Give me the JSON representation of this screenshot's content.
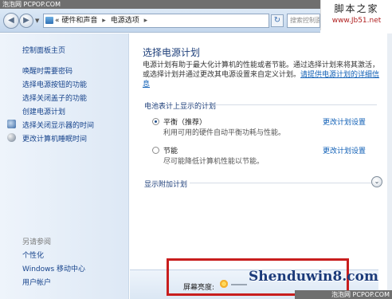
{
  "watermarks": {
    "top_left": "泡泡网 PCPOP.COM",
    "top_right_big": "脚本之家",
    "top_right_small": "www.Jb51.net",
    "center_brand": "Shenduwin8.com",
    "bottom_right": "泡泡网 PCPOP.COM"
  },
  "addressbar": {
    "back_icon": "back-arrow",
    "forward_icon": "forward-arrow",
    "breadcrumb": [
      "«",
      "硬件和声音",
      "▸",
      "电源选项",
      "▸"
    ],
    "search_placeholder": "搜索控制面板"
  },
  "sidebar": {
    "home": "控制面板主页",
    "tasks": [
      {
        "label": "唤醒时需要密码"
      },
      {
        "label": "选择电源按钮的功能"
      },
      {
        "label": "选择关闭盖子的功能"
      },
      {
        "label": "创建电源计划"
      },
      {
        "label": "选择关闭显示器的时间",
        "icon": "monitor-icon"
      },
      {
        "label": "更改计算机睡眠时间",
        "icon": "moon-icon"
      }
    ],
    "see_also_title": "另请参阅",
    "see_also": [
      "个性化",
      "Windows 移动中心",
      "用户帐户"
    ]
  },
  "main": {
    "title": "选择电源计划",
    "description": "电源计划有助于最大化计算机的性能或者节能。通过选择计划来将其激活，或选择计划并通过更改其电源设置来自定义计划。",
    "description_link": "请提供电源计划的详细信息",
    "battery_plans_header": "电池表计上显示的计划",
    "plans": [
      {
        "name": "平衡（推荐）",
        "desc": "利用可用的硬件自动平衡功耗与性能。",
        "change": "更改计划设置",
        "selected": true
      },
      {
        "name": "节能",
        "desc": "尽可能降低计算机性能以节能。",
        "change": "更改计划设置",
        "selected": false
      }
    ],
    "show_more": "显示附加计划"
  },
  "bottom": {
    "brightness_label": "屏幕亮度:"
  },
  "colors": {
    "highlight_box": "#c81e1e",
    "link": "#0f5fb6",
    "title": "#1e3f7a"
  }
}
